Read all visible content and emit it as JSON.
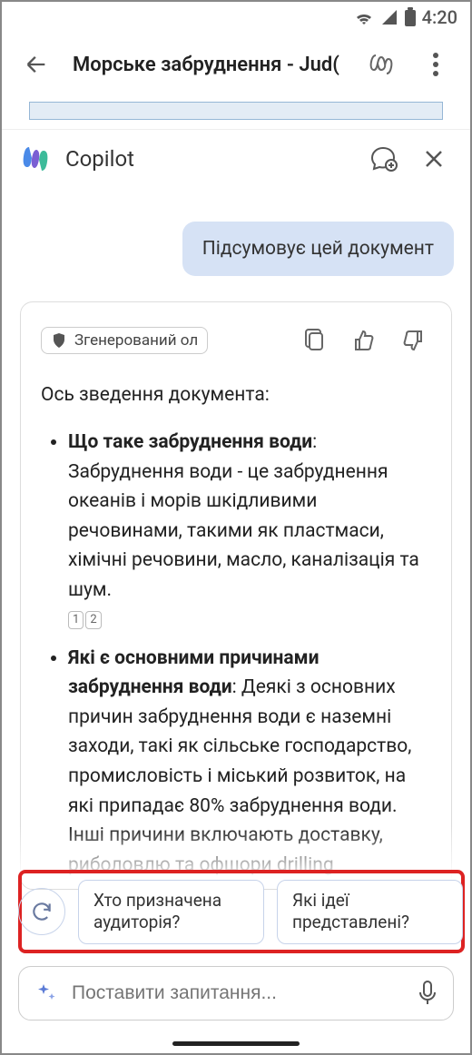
{
  "status": {
    "time": "4:20"
  },
  "app_header": {
    "title": "Морське забруднення - Jud("
  },
  "copilot": {
    "title": "Copilot"
  },
  "user_message": "Підсумовує цей документ",
  "response": {
    "generated_label": "Згенерований ол",
    "intro": "Ось зведення документа:",
    "items": [
      {
        "title": "Що таке забруднення води",
        "body": "Забруднення води - це забруднення океанів і морів шкідливими речовинами, такими як пластмаси, хімічні речовини, масло, каналізація та шум.",
        "refs": [
          "1",
          "2"
        ]
      },
      {
        "title": "Які є основними причинами забруднення води",
        "body": "Деякі з основних причин забруднення води є наземні заходи, такі як сільське господарство, промисловість і міський розвиток, на які припадає 80% забруднення води. Інші причини включають доставку, риболовлю та офшори drilling",
        "refs": []
      }
    ]
  },
  "suggestions": [
    "Хто призначена аудиторія?",
    "Які ідеї представлені?"
  ],
  "input": {
    "placeholder": "Поставити запитання..."
  }
}
